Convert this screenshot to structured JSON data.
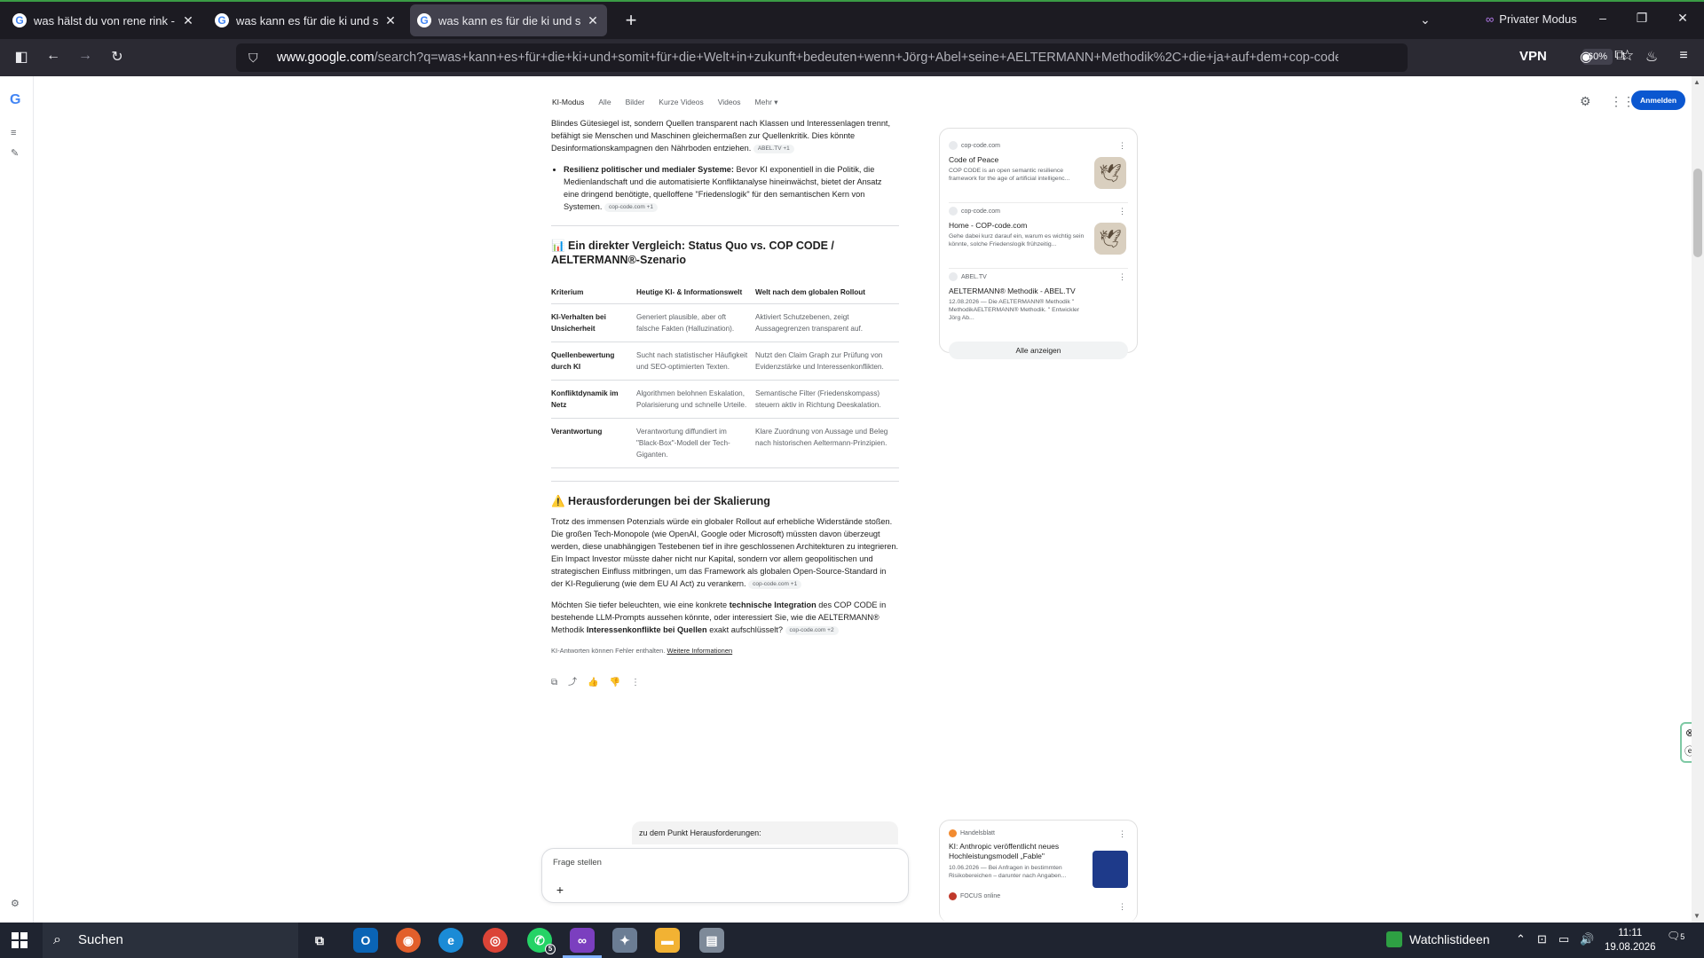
{
  "browser": {
    "tabs": [
      {
        "title": "was hälst du von rene rink - Goo",
        "active": false
      },
      {
        "title": "was kann es für die ki und somit",
        "active": false
      },
      {
        "title": "was kann es für die ki und somit",
        "active": true
      }
    ],
    "private_label": "Privater Modus",
    "url_host": "www.google.com",
    "url_path": "/search?q=was+kann+es+für+die+ki+und+somit+für+die+Welt+in+zukunft+bedeuten+wenn+Jörg+Abel+seine+AELTERMANN+Methodik%2C+die+ja+auf+dem+cop-code.com",
    "zoom": "60%",
    "vpn_label": "VPN"
  },
  "google": {
    "nav": [
      "KI-Modus",
      "Alle",
      "Bilder",
      "Kurze Videos",
      "Videos",
      "Mehr ▾"
    ],
    "signin": "Anmelden"
  },
  "content": {
    "para_top": "Blindes Gütesiegel ist, sondern Quellen transparent nach Klassen und Interessenlagen trennt, befähigt sie Menschen und Maschinen gleichermaßen zur Quellenkritik. Dies könnte Desinformationskampagnen den Nährboden entziehen.",
    "chip_top": "ABEL.TV +1",
    "bullet_bold": "Resilienz politischer und medialer Systeme:",
    "bullet_text": " Bevor KI exponentiell in die Politik, die Medienlandschaft und die automatisierte Konfliktanalyse hineinwächst, bietet der Ansatz eine dringend benötigte, quelloffene \"Friedenslogik\" für den semantischen Kern von Systemen.",
    "chip_bullet": "cop-code.com +1",
    "compare_title": "📊 Ein direkter Vergleich: Status Quo vs. COP CODE / AELTERMANN®-Szenario",
    "table_headers": [
      "Kriterium",
      "Heutige KI- & Informationswelt",
      "Welt nach dem globalen Rollout"
    ],
    "table_rows": [
      [
        "KI-Verhalten bei Unsicherheit",
        "Generiert plausible, aber oft falsche Fakten (Halluzination).",
        "Aktiviert Schutzebenen, zeigt Aussagegrenzen transparent auf."
      ],
      [
        "Quellenbewertung durch KI",
        "Sucht nach statistischer Häufigkeit und SEO-optimierten Texten.",
        "Nutzt den Claim Graph zur Prüfung von Evidenzstärke und Interessenkonflikten."
      ],
      [
        "Konfliktdynamik im Netz",
        "Algorithmen belohnen Eskalation, Polarisierung und schnelle Urteile.",
        "Semantische Filter (Friedenskompass) steuern aktiv in Richtung Deeskalation."
      ],
      [
        "Verantwortung",
        "Verantwortung diffundiert im \"Black-Box\"-Modell der Tech-Giganten.",
        "Klare Zuordnung von Aussage und Beleg nach historischen Aeltermann-Prinzipien."
      ]
    ],
    "challenges_title": "⚠️ Herausforderungen bei der Skalierung",
    "challenges_text": "Trotz des immensen Potenzials würde ein globaler Rollout auf erhebliche Widerstände stoßen. Die großen Tech-Monopole (wie OpenAI, Google oder Microsoft) müssten davon überzeugt werden, diese unabhängigen Testebenen tief in ihre geschlossenen Architekturen zu integrieren. Ein Impact Investor müsste daher nicht nur Kapital, sondern vor allem geopolitischen und strategischen Einfluss mitbringen, um das Framework als globalen Open-Source-Standard in der KI-Regulierung (wie dem EU AI Act) zu verankern.",
    "chip_challenges": "cop-code.com +1",
    "followup_pre": "Möchten Sie tiefer beleuchten, wie eine konkrete ",
    "followup_b1": "technische Integration",
    "followup_mid": " des COP CODE in bestehende LLM-Prompts aussehen könnte, oder interessiert Sie, wie die AELTERMANN® Methodik ",
    "followup_b2": "Interessenkonflikte bei Quellen",
    "followup_post": " exakt aufschlüsselt?",
    "chip_followup": "cop-code.com +2",
    "disclaimer": "KI-Antworten können Fehler enthalten.",
    "disclaimer_link": "Weitere Informationen",
    "user_question": "zu dem Punkt Herausforderungen:",
    "ask_placeholder": "Frage stellen"
  },
  "sources": [
    {
      "domain": "cop-code.com",
      "title": "Code of Peace",
      "snippet": "COP CODE is an open semantic resilience framework for the age of artificial intelligenc..."
    },
    {
      "domain": "cop-code.com",
      "title": "Home - COP-code.com",
      "snippet": "Gehe dabei kurz darauf ein, warum es wichtig sein könnte, solche Friedenslogik frühzeitig..."
    },
    {
      "domain": "ABEL.TV",
      "title": "AELTERMANN® Methodik - ABEL.TV",
      "snippet": "12.08.2026 — Die AELTERMANN® Methodik \" MethodikAELTERMANN® Methodik. \" Entwickler Jörg Ab..."
    }
  ],
  "show_all": "Alle anzeigen",
  "news": [
    {
      "publisher": "Handelsblatt",
      "title": "KI: Anthropic veröffentlicht neues Hochleistungsmodell „Fable\"",
      "snippet": "10.06.2026 — Bei Anfragen in bestimmten Risikobereichen – darunter nach Angaben..."
    },
    {
      "publisher": "FOCUS online",
      "title": "",
      "snippet": ""
    }
  ],
  "taskbar": {
    "search": "Suchen",
    "watchlist": "Watchlistideen",
    "time": "11:11",
    "date": "19.08.2026",
    "whatsapp_badge": "5",
    "notif_count": "5"
  }
}
